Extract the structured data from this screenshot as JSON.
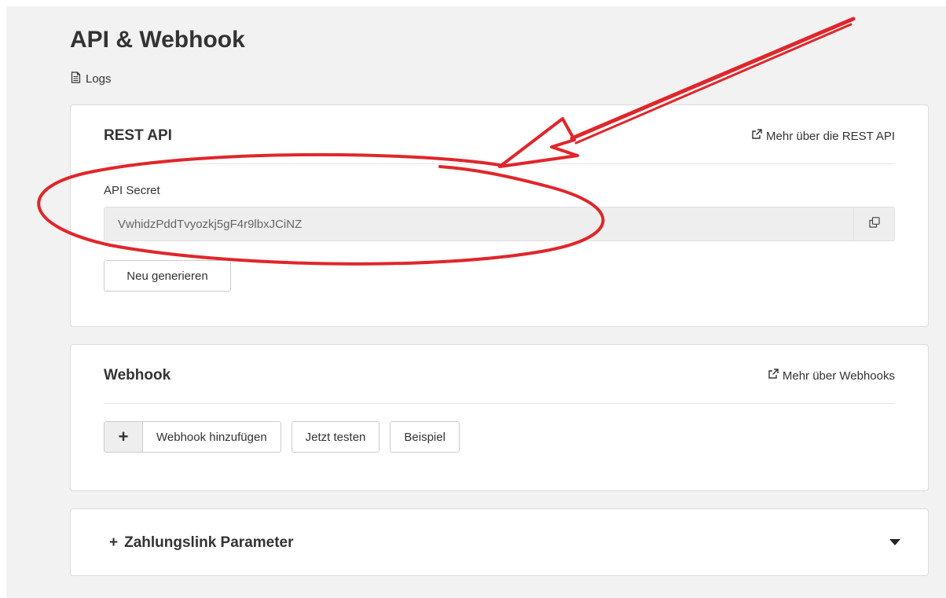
{
  "page": {
    "title": "API & Webhook",
    "logs_label": "Logs"
  },
  "rest_api": {
    "title": "REST API",
    "more_link": "Mehr über die REST API",
    "secret_label": "API Secret",
    "secret_value": "VwhidzPddTvyozkj5gF4r9lbxJCiNZ",
    "regenerate_button": "Neu generieren"
  },
  "webhook": {
    "title": "Webhook",
    "more_link": "Mehr über Webhooks",
    "add_button_plus": "+",
    "add_button": "Webhook hinzufügen",
    "test_button": "Jetzt testen",
    "example_button": "Beispiel"
  },
  "payment_link": {
    "plus": "+",
    "title": "Zahlungslink Parameter"
  },
  "icons": {
    "logs": "document-icon",
    "external_link": "external-link-icon",
    "copy": "copy-icon",
    "collapse": "caret-down-icon"
  },
  "colors": {
    "annotation": "#e0262b",
    "page_bg": "#f2f2f2",
    "card_bg": "#ffffff",
    "input_bg": "#eeeeee",
    "text": "#333333"
  }
}
